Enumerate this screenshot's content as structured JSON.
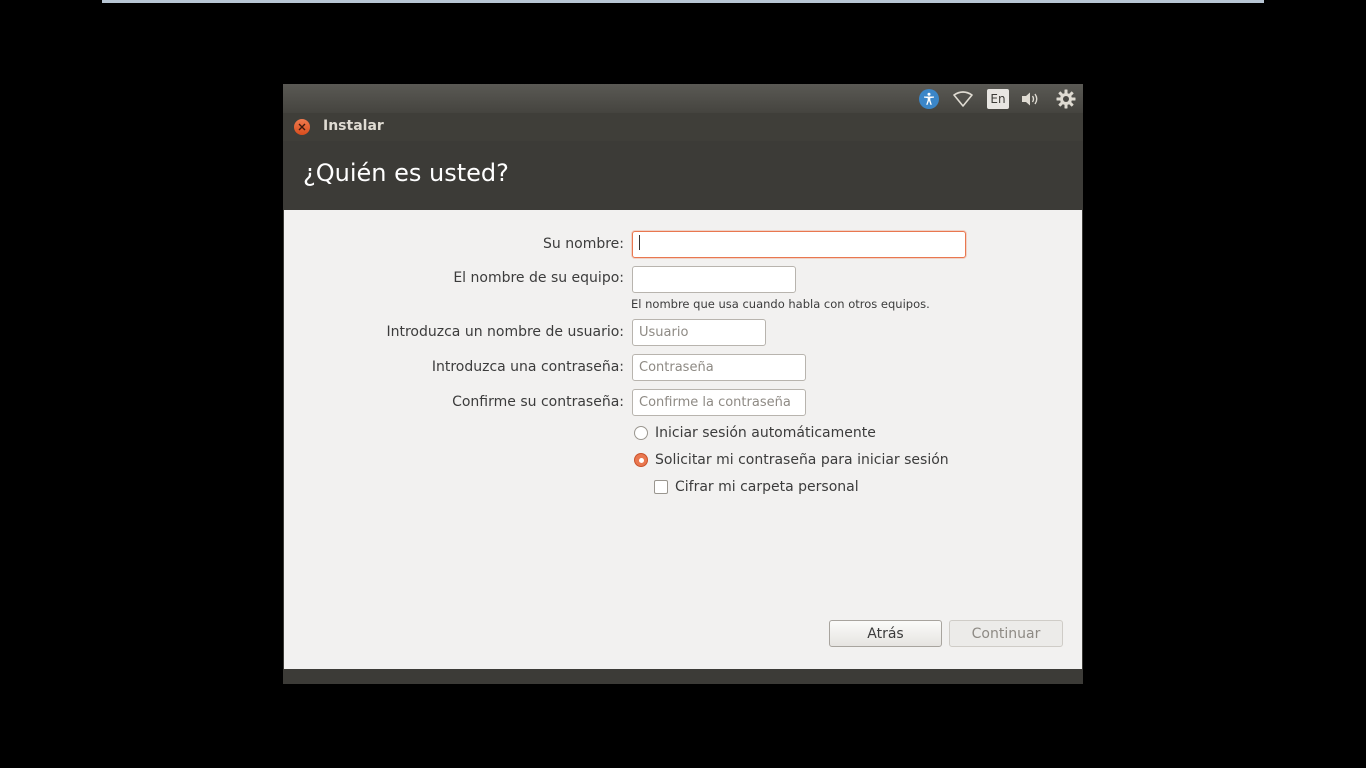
{
  "panel": {
    "indicators": [
      {
        "icon": "accessibility-icon"
      },
      {
        "icon": "wifi-icon"
      },
      {
        "icon": "keyboard-layout-icon",
        "label": "En"
      },
      {
        "icon": "volume-icon"
      },
      {
        "icon": "settings-gear-icon"
      }
    ]
  },
  "window": {
    "title": "Instalar",
    "page_title": "¿Quién es usted?"
  },
  "form": {
    "name_label": "Su nombre:",
    "name_value": "",
    "computer_label": "El nombre de su equipo:",
    "computer_value": "",
    "computer_hint": "El nombre que usa cuando habla con otros equipos.",
    "username_label": "Introduzca un nombre de usuario:",
    "username_placeholder": "Usuario",
    "password_label": "Introduzca una contraseña:",
    "password_placeholder": "Contraseña",
    "confirm_label": "Confirme su contraseña:",
    "confirm_placeholder": "Confirme la contraseña"
  },
  "options": {
    "auto_login": {
      "label": "Iniciar sesión automáticamente",
      "selected": false
    },
    "require_password": {
      "label": "Solicitar mi contraseña para iniciar sesión",
      "selected": true
    },
    "encrypt_home": {
      "label": "Cifrar mi carpeta personal",
      "checked": false
    }
  },
  "buttons": {
    "back": "Atrás",
    "continue": "Continuar"
  },
  "colors": {
    "accent": "#e9774f",
    "panel_bg": "#3c3b37",
    "content_bg": "#f2f1f0",
    "accessibility_blue": "#3b86c8"
  }
}
